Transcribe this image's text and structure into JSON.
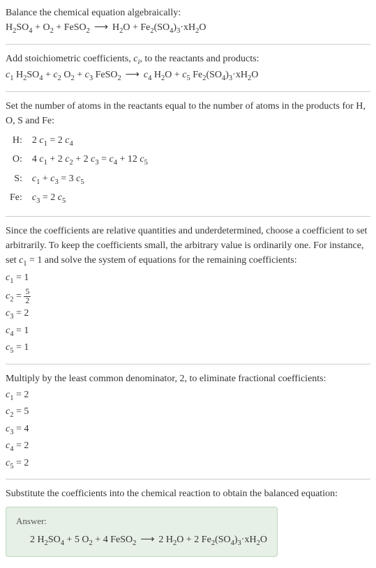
{
  "step1": {
    "intro": "Balance the chemical equation algebraically:",
    "equation_left": "H",
    "eq_parts": {
      "h2so4": "H",
      "so4": "SO",
      "o2": "O",
      "feso2": "FeSO",
      "h2o": "H",
      "o": "O",
      "fe2so43": "Fe",
      "xh2o": "·xH"
    }
  },
  "step2": {
    "intro_a": "Add stoichiometric coefficients, ",
    "intro_b": ", to the reactants and products:"
  },
  "step3": {
    "intro": "Set the number of atoms in the reactants equal to the number of atoms in the products for H, O, S and Fe:",
    "rows": [
      {
        "el": "H:",
        "eq": "2 c₁ = 2 c₄"
      },
      {
        "el": "O:",
        "eq": "4 c₁ + 2 c₂ + 2 c₃ = c₄ + 12 c₅"
      },
      {
        "el": "S:",
        "eq": "c₁ + c₃ = 3 c₅"
      },
      {
        "el": "Fe:",
        "eq": "c₃ = 2 c₅"
      }
    ]
  },
  "step4": {
    "intro": "Since the coefficients are relative quantities and underdetermined, choose a coefficient to set arbitrarily. To keep the coefficients small, the arbitrary value is ordinarily one. For instance, set c₁ = 1 and solve the system of equations for the remaining coefficients:",
    "c1": "c₁ = 1",
    "c2a": "c₂ = ",
    "c2num": "5",
    "c2den": "2",
    "c3": "c₃ = 2",
    "c4": "c₄ = 1",
    "c5": "c₅ = 1"
  },
  "step5": {
    "intro": "Multiply by the least common denominator, 2, to eliminate fractional coefficients:",
    "c1": "c₁ = 2",
    "c2": "c₂ = 5",
    "c3": "c₃ = 4",
    "c4": "c₄ = 2",
    "c5": "c₅ = 2"
  },
  "step6": {
    "intro": "Substitute the coefficients into the chemical reaction to obtain the balanced equation:"
  },
  "answer": {
    "label": "Answer:",
    "coef1": "2 ",
    "coef2": " + 5 ",
    "coef3": " + 4 ",
    "coef4": "2 ",
    "coef5": " + 2 "
  },
  "chem": {
    "H2SO4": "H₂SO₄",
    "O2": "O₂",
    "FeSO2": "FeSO₂",
    "H2O": "H₂O",
    "Fe2SO43xH2O": "Fe₂(SO₄)₃·xH₂O",
    "arrow": "⟶",
    "plus": " + "
  },
  "sub": {
    "s2": "2",
    "s3": "3",
    "s4": "4",
    "s1": "1",
    "s5": "5",
    "ci": "c",
    "cii": "i"
  }
}
